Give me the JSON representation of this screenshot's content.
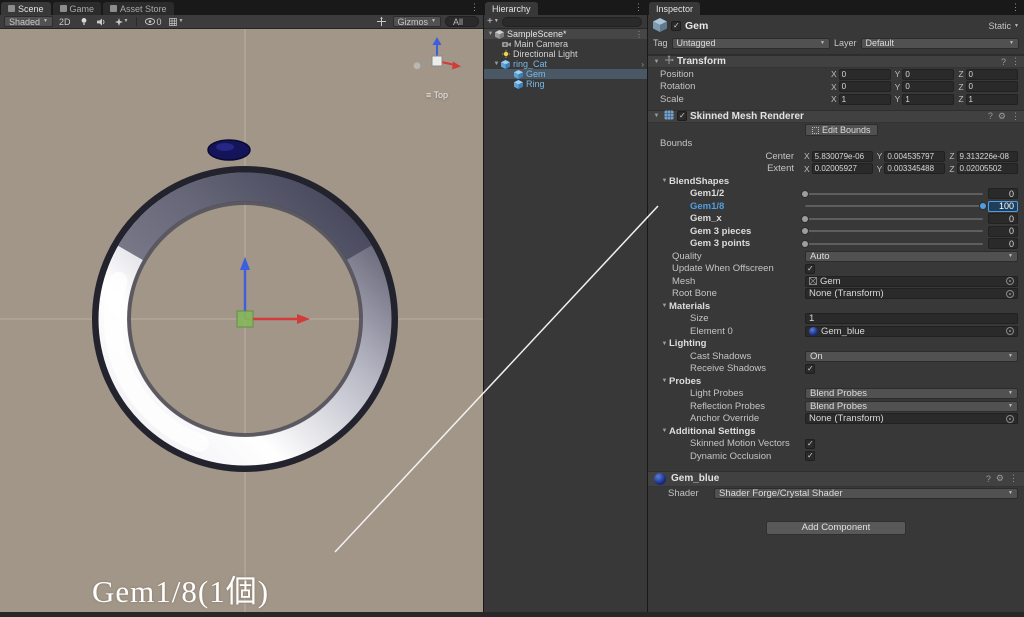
{
  "colors": {
    "accent_blue": "#4F9EE3",
    "prefab_blue": "#7AB8E8",
    "viewport_bg": "#A29688"
  },
  "scene": {
    "tabs": [
      {
        "label": "Scene"
      },
      {
        "label": "Game"
      },
      {
        "label": "Asset Store"
      }
    ],
    "toolbar": {
      "shading_mode": "Shaded",
      "toggle_2d": "2D",
      "hidden_count": "0",
      "gizmos": "Gizmos",
      "search_value": "All"
    },
    "orientation_label": "Top",
    "annotation": "Gem1/8(1個)"
  },
  "hierarchy": {
    "tab": "Hierarchy",
    "create_button": "+",
    "scene_row": {
      "label": "SampleScene*"
    },
    "items": [
      {
        "label": "Main Camera"
      },
      {
        "label": "Directional Light"
      },
      {
        "label": "ring_Cat"
      },
      {
        "label": "Gem"
      },
      {
        "label": "Ring"
      }
    ]
  },
  "inspector": {
    "tab": "Inspector",
    "header": {
      "name": "Gem",
      "static_label": "Static",
      "tag_label": "Tag",
      "tag_value": "Untagged",
      "layer_label": "Layer",
      "layer_value": "Default"
    },
    "transform": {
      "title": "Transform",
      "axis_x": "X",
      "axis_y": "Y",
      "axis_z": "Z",
      "rows": [
        {
          "label": "Position",
          "x": "0",
          "y": "0",
          "z": "0"
        },
        {
          "label": "Rotation",
          "x": "0",
          "y": "0",
          "z": "0"
        },
        {
          "label": "Scale",
          "x": "1",
          "y": "1",
          "z": "1"
        }
      ]
    },
    "smr": {
      "title": "Skinned Mesh Renderer",
      "edit_bounds_label": "Edit Bounds",
      "bounds_label": "Bounds",
      "center_label": "Center",
      "center": {
        "x": "5.830079e-06",
        "y": "0.004535797",
        "z": "9.313226e-08"
      },
      "extent_label": "Extent",
      "extent": {
        "x": "0.02005927",
        "y": "0.003345488",
        "z": "0.02005502"
      },
      "blendshapes_title": "BlendShapes",
      "blendshapes": [
        {
          "label": "Gem1/2",
          "value": "0",
          "t": 0
        },
        {
          "label": "Gem1/8",
          "value": "100",
          "t": 1
        },
        {
          "label": "Gem_x",
          "value": "0",
          "t": 0
        },
        {
          "label": "Gem 3 pieces",
          "value": "0",
          "t": 0
        },
        {
          "label": "Gem 3 points",
          "value": "0",
          "t": 0
        }
      ],
      "quality_label": "Quality",
      "quality_value": "Auto",
      "update_offscreen_label": "Update When Offscreen",
      "mesh_label": "Mesh",
      "mesh_value": "Gem",
      "root_bone_label": "Root Bone",
      "root_bone_value": "None (Transform)",
      "materials_title": "Materials",
      "size_label": "Size",
      "size_value": "1",
      "element0_label": "Element 0",
      "element0_value": "Gem_blue",
      "lighting_title": "Lighting",
      "cast_shadows_label": "Cast Shadows",
      "cast_shadows_value": "On",
      "receive_shadows_label": "Receive Shadows",
      "probes_title": "Probes",
      "light_probes_label": "Light Probes",
      "light_probes_value": "Blend Probes",
      "reflection_probes_label": "Reflection Probes",
      "reflection_probes_value": "Blend Probes",
      "anchor_override_label": "Anchor Override",
      "anchor_override_value": "None (Transform)",
      "additional_title": "Additional Settings",
      "motion_vectors_label": "Skinned Motion Vectors",
      "dynamic_occlusion_label": "Dynamic Occlusion"
    },
    "material": {
      "name": "Gem_blue",
      "shader_label": "Shader",
      "shader_value": "Shader Forge/Crystal Shader"
    },
    "add_component_label": "Add Component"
  }
}
